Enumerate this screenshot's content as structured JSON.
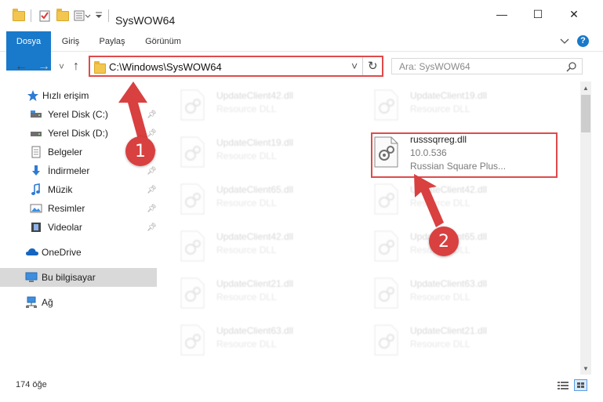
{
  "window": {
    "title": "SysWOW64",
    "minimize": "—",
    "maximize": "☐",
    "close": "✕"
  },
  "ribbon": {
    "tabs": [
      "Dosya",
      "Giriş",
      "Paylaş",
      "Görünüm"
    ],
    "expand_icon": "chevron-down-icon",
    "help": "?"
  },
  "nav": {
    "back": "←",
    "forward": "→",
    "recent": "˅",
    "up": "↑",
    "address": "C:\\Windows\\SysWOW64",
    "address_dropdown": "˅",
    "refresh": "↻",
    "search_placeholder": "Ara: SysWOW64"
  },
  "sidebar": {
    "items": [
      {
        "label": "Hızlı erişim",
        "icon": "star-icon"
      },
      {
        "label": "Yerel Disk (C:)",
        "icon": "drive-icon",
        "pinned": true
      },
      {
        "label": "Yerel Disk (D:)",
        "icon": "drive-icon",
        "pinned": true
      },
      {
        "label": "Belgeler",
        "icon": "documents-icon",
        "pinned": true
      },
      {
        "label": "İndirmeler",
        "icon": "download-icon",
        "pinned": true
      },
      {
        "label": "Müzik",
        "icon": "music-icon",
        "pinned": true
      },
      {
        "label": "Resimler",
        "icon": "pictures-icon",
        "pinned": true
      },
      {
        "label": "Videolar",
        "icon": "video-icon",
        "pinned": true
      },
      {
        "label": "OneDrive",
        "icon": "cloud-icon"
      },
      {
        "label": "Bu bilgisayar",
        "icon": "computer-icon",
        "selected": true
      },
      {
        "label": "Ağ",
        "icon": "network-icon"
      }
    ]
  },
  "files": [
    {
      "name": "UpdateClient42.dll",
      "desc": "Resource DLL"
    },
    {
      "name": "UpdateClient19.dll",
      "desc": "Resource DLL"
    },
    {
      "name": "UpdateClient19.dll",
      "desc": "Resource DLL"
    },
    {
      "name": "russsqrreg.dll",
      "desc": "10.0.536",
      "desc2": "Russian Square Plus..."
    },
    {
      "name": "UpdateClient65.dll",
      "desc": "Resource DLL"
    },
    {
      "name": "UpdateClient42.dll",
      "desc": "Resource DLL"
    },
    {
      "name": "UpdateClient42.dll",
      "desc": "Resource DLL"
    },
    {
      "name": "UpdateClient65.dll",
      "desc": "Resource DLL"
    },
    {
      "name": "UpdateClient21.dll",
      "desc": "Resource DLL"
    },
    {
      "name": "UpdateClient63.dll",
      "desc": "Resource DLL"
    },
    {
      "name": "UpdateClient63.dll",
      "desc": "Resource DLL"
    },
    {
      "name": "UpdateClient21.dll",
      "desc": "Resource DLL"
    }
  ],
  "status": {
    "count": "174 öğe"
  },
  "annotations": {
    "step1": "1",
    "step2": "2",
    "accent": "#d94040"
  },
  "colors": {
    "file_tab": "#1979ca",
    "highlight": "#e04a4a",
    "folder": "#f3c650"
  }
}
